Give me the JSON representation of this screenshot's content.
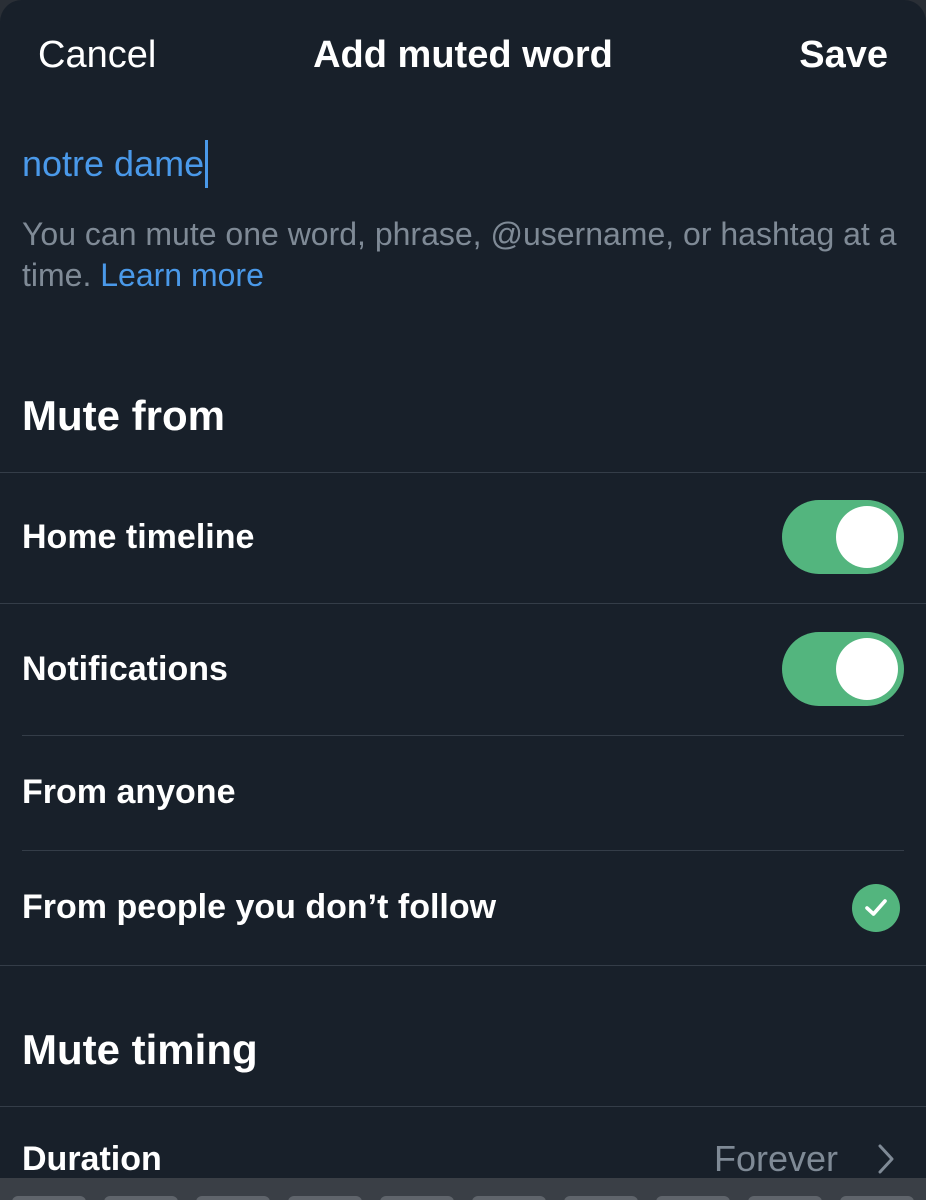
{
  "nav": {
    "cancel_label": "Cancel",
    "title": "Add muted word",
    "save_label": "Save"
  },
  "word_input": {
    "value": "notre dame"
  },
  "helper": {
    "text": "You can mute one word, phrase, @username, or hashtag at a time. ",
    "link_label": "Learn more"
  },
  "mute_from": {
    "title": "Mute from",
    "home_timeline": {
      "label": "Home timeline",
      "enabled": true
    },
    "notifications": {
      "label": "Notifications",
      "enabled": true
    },
    "from_anyone": {
      "label": "From anyone",
      "selected": false
    },
    "from_non_followers": {
      "label": "From people you don’t follow",
      "selected": true
    }
  },
  "mute_timing": {
    "title": "Mute timing",
    "duration_label": "Duration",
    "duration_value": "Forever"
  },
  "colors": {
    "background": "#18202a",
    "accent_blue": "#4a99e9",
    "toggle_green": "#53b57e",
    "muted_text": "#7f8a96"
  }
}
